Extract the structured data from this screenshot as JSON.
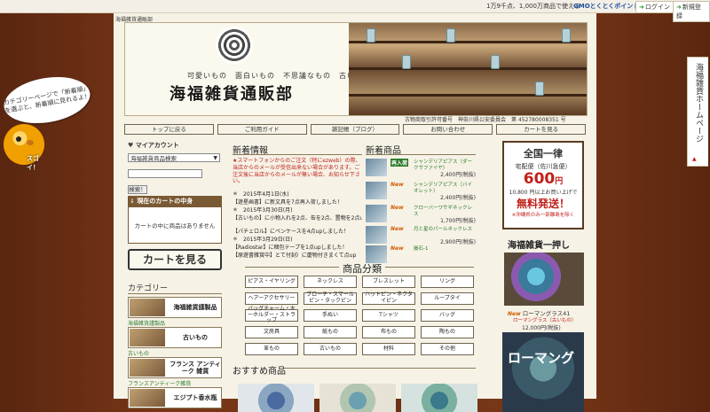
{
  "topbar": {
    "tagline": "1万9千点、1,000万商品で使える",
    "gmo": "GMOとくとくポイント",
    "login": "ログイン",
    "register": "新規登録"
  },
  "crumb": "海福雑貨通販部",
  "banner": {
    "catchcopy": "可愛いもの　面白いもの　不思議なもの　古いもの",
    "title": "海福雑貨通販部"
  },
  "license": "古物商取引許可番号　神奈川県公安委員会　第 452780008351 号",
  "nav": [
    "トップに戻る",
    "ご利用ガイド",
    "雑記帳（ブログ）",
    "お問い合わせ",
    "カートを見る"
  ],
  "account": {
    "label": "マイアカウント"
  },
  "search": {
    "select_value": "海福雑貨商品検索",
    "button": "検索！"
  },
  "cart": {
    "heading": "現在のカートの中身",
    "empty": "カートの中に商品はありません",
    "view_button": "カートを見る"
  },
  "category": {
    "title": "カテゴリー",
    "items": [
      {
        "label": "海福雑貨謹製品",
        "caption": "海福雑貨謹製品"
      },
      {
        "label": "古いもの",
        "caption": "古いもの"
      },
      {
        "label": "フランス アンティーク 雑貨",
        "caption": "フランスアンティーク雑貨"
      },
      {
        "label": "エジプト香水瓶",
        "caption": ""
      }
    ]
  },
  "news": {
    "title": "新着情報",
    "notice": "★スマートフォンからのご注文（特にezweb）の際、当店からのメールが受信出来ない場合があります。ご注文後に当店からのメールが無い場合、お知らせ下さい。",
    "lines": [
      "＊　2015年4月1日(水)",
      "【遊星画書】に新文具を7点再入荷しました！",
      "＊　2015年3月30日(月)",
      "【古いもの】に小物入れを2点、缶を2点、置物を2点upしました！",
      "【パチェロル】にペンケースを4点upしました！",
      "＊　2015年3月29日(日)",
      "【Radiostar】に梱包テープを1点upしました！",
      "【原遊書雑賞中】とて付刻）に慶物付きまくて点up"
    ]
  },
  "new_items": {
    "title": "新着商品",
    "items": [
      {
        "badge": "再入荷",
        "name": "シャンデリアピアス（ダークサファイヤ）",
        "price": "2,400円(税抜)"
      },
      {
        "badge": "New",
        "name": "シャンデリアピアス（バイオレット）",
        "price": "2,400円(税抜)"
      },
      {
        "badge": "New",
        "name": "クローバーワサギネックレス",
        "price": "1,700円(税抜)"
      },
      {
        "badge": "New",
        "name": "月と星のパールネックレス",
        "price": "2,900円(税抜)"
      },
      {
        "badge": "New",
        "name": "嵌石-1",
        "price": ""
      }
    ]
  },
  "promo": {
    "l1": "全国一律",
    "l2": "宅配便（佐川急便）",
    "price": "600",
    "unit": "円",
    "l4": "10,800 円以上お買い上げで",
    "l5": "無料発送！",
    "l6": "※沖縄県のみ一部離島を除く"
  },
  "recommend": {
    "title": "海福雑貨一押し",
    "badge": "New",
    "name": "ローマングラス41",
    "sub": "ローマングラス（古いもの）",
    "price": "12,000円(税抜)",
    "banner_text": "ローマング"
  },
  "product_grid": {
    "title": "商品分類",
    "cells": [
      "ピアス・イヤリング",
      "ネックレス",
      "ブレスレット",
      "リング",
      "ヘアーアクセサリー",
      "ブローチ・スマールピン・タックピン",
      "ハットピン・ネクタイピン",
      "ループタイ",
      "バッグチャーム・キーホルダー・ストラップ",
      "手ぬい",
      "Tシャツ",
      "バッグ",
      "文房具",
      "紙もの",
      "布もの",
      "陶もの",
      "革もの",
      "古いもの",
      "材料",
      "その他"
    ]
  },
  "osusume": {
    "title": "おすすめ商品"
  },
  "bubble": {
    "text": "カテゴリーページで「新着順」を選ぶと、新着順に見れるよ！"
  },
  "chick": {
    "text": "スゴイ！"
  },
  "side_tab": {
    "text": "海福雑貨ホームページ",
    "arrow": "▲"
  },
  "colors": {
    "accent": "#c0201a",
    "green": "#2a7a2a",
    "wood": "#6b2f14"
  }
}
